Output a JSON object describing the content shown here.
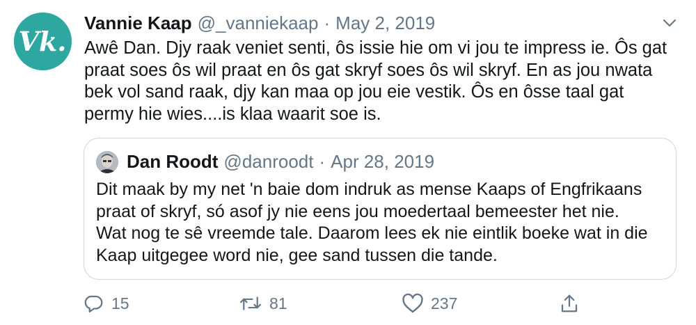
{
  "tweet": {
    "avatar_text": "Vk.",
    "display_name": "Vannie Kaap",
    "handle": "@_vanniekaap",
    "separator": "·",
    "date": "May 2, 2019",
    "text_lines": [
      "Awê Dan. Djy raak veniet senti, ôs issie hie om vi jou te impress ie. Ôs gat",
      "praat soes ôs wil praat en ôs gat skryf soes ôs wil skryf. En as jou nwata",
      "bek vol sand raak, djy kan maa op jou eie vestik. Ôs en ôsse taal gat",
      "permy hie wies....is klaa waarit soe is."
    ]
  },
  "quoted_tweet": {
    "display_name": "Dan Roodt",
    "handle": "@danroodt",
    "separator": "·",
    "date": "Apr 28, 2019",
    "text_lines": [
      "Dit maak by my net 'n baie dom indruk as mense Kaaps of Engfrikaans",
      "praat of skryf, só asof jy nie eens jou moedertaal bemeester het nie.",
      "Wat nog te sê vreemde tale. Daarom lees ek nie eintlik boeke wat in die",
      "Kaap uitgegee word nie, gee sand tussen die tande."
    ]
  },
  "actions": {
    "reply_count": "15",
    "retweet_count": "81",
    "like_count": "237"
  },
  "icons": {
    "caret": "chevron-down-icon",
    "reply": "reply-icon",
    "retweet": "retweet-icon",
    "like": "heart-icon",
    "share": "share-icon"
  },
  "colors": {
    "avatar_bg": "#2fa7a1",
    "secondary_text": "#657786",
    "border": "#ccd6dd"
  }
}
